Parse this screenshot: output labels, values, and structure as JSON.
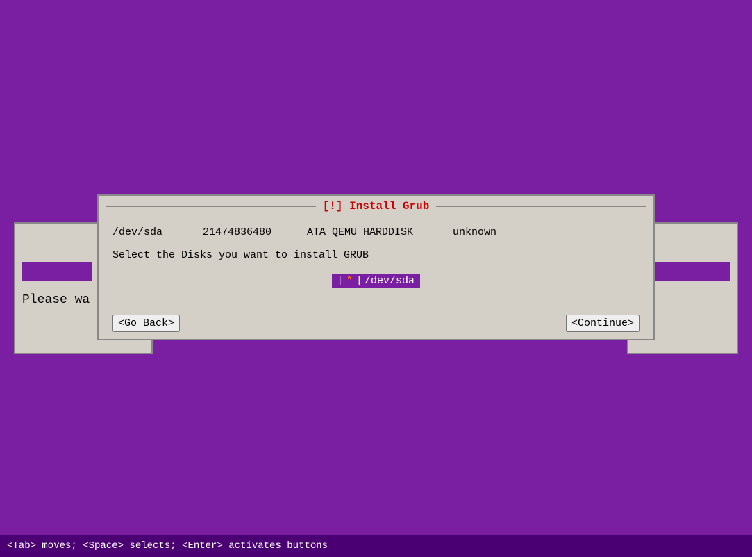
{
  "background": {
    "color": "#7b1fa2"
  },
  "bg_dialog_left": {
    "please_wait_text": "Please wa"
  },
  "main_dialog": {
    "title": "[!] Install Grub",
    "disk_device": "/dev/sda",
    "disk_size": "21474836480",
    "disk_model": "ATA QEMU HARDDISK",
    "disk_type": "unknown",
    "select_label": "Select the Disks you want to install GRUB",
    "checkbox_selected_value": "/dev/sda",
    "checkbox_marker": "*",
    "go_back_label": "<Go Back>",
    "continue_label": "<Continue>"
  },
  "status_bar": {
    "text": "<Tab> moves; <Space> selects; <Enter> activates buttons"
  }
}
